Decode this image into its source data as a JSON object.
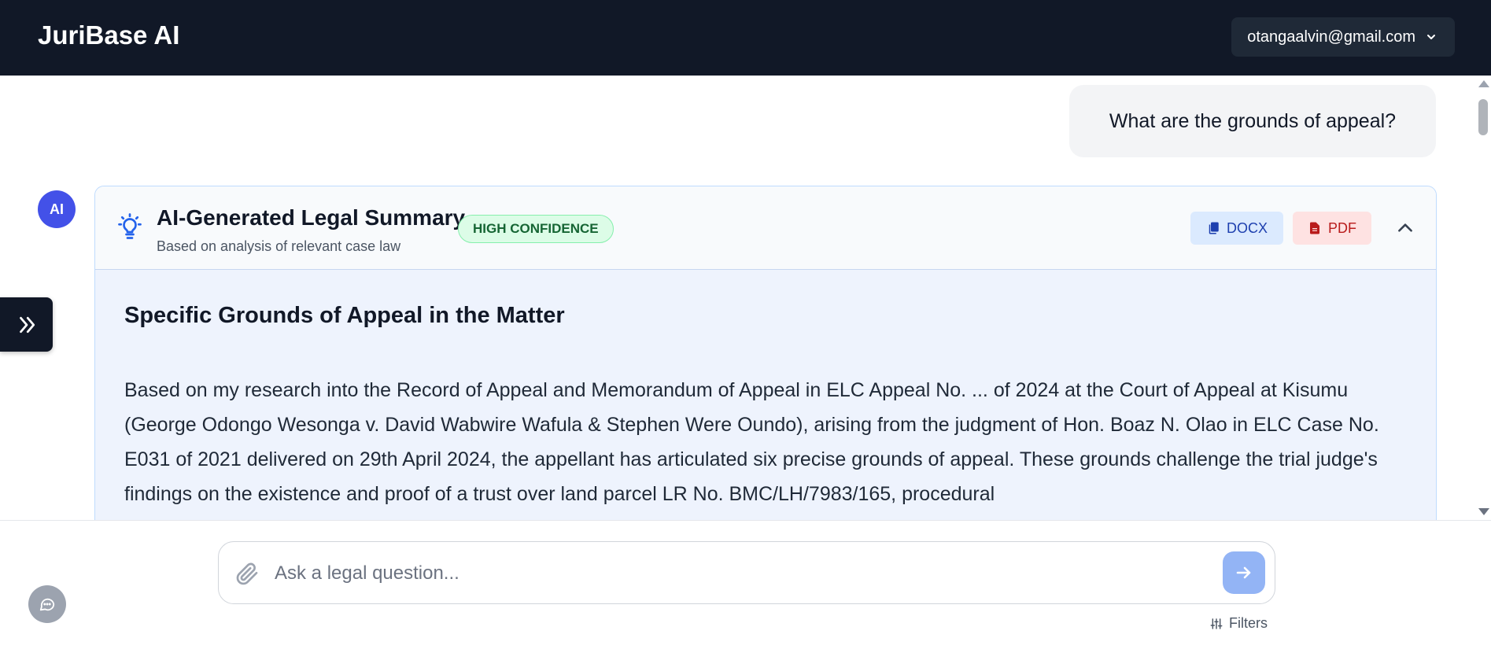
{
  "header": {
    "brand": "JuriBase AI",
    "user_email": "otangaalvin@gmail.com"
  },
  "chat": {
    "user_message": "What are the grounds of appeal?",
    "ai_avatar_label": "AI",
    "summary": {
      "title": "AI-Generated Legal Summary",
      "subtitle": "Based on analysis of relevant case law",
      "confidence_badge": "HIGH CONFIDENCE",
      "docx_label": "DOCX",
      "pdf_label": "PDF",
      "heading": "Specific Grounds of Appeal in the Matter",
      "body": "Based on my research into the Record of Appeal and Memorandum of Appeal in ELC Appeal No. ... of 2024 at the Court of Appeal at Kisumu (George Odongo Wesonga v. David Wabwire Wafula & Stephen Were Oundo), arising from the judgment of Hon. Boaz N. Olao in ELC Case No. E031 of 2021 delivered on 29th April 2024, the appellant has articulated six precise grounds of appeal. These grounds challenge the trial judge's findings on the existence and proof of a trust over land parcel LR No. BMC/LH/7983/165, procedural"
    }
  },
  "composer": {
    "placeholder": "Ask a legal question...",
    "filters_label": "Filters"
  },
  "icons": {
    "user_menu": "chevron-down-icon",
    "summary": "lightbulb-icon",
    "docx": "copy-icon",
    "pdf": "file-icon",
    "collapse": "chevron-up-icon",
    "sidebar": "double-chevron-right-icon",
    "attach": "paperclip-icon",
    "send": "arrow-right-icon",
    "filters": "sliders-icon",
    "feedback": "chat-bubble-icon"
  },
  "colors": {
    "header_bg": "#111827",
    "avatar": "#4351e8",
    "badge_green": "#166534",
    "docx_blue": "#1e40af",
    "pdf_red": "#b91c1c",
    "send_button": "#93b4f5"
  }
}
